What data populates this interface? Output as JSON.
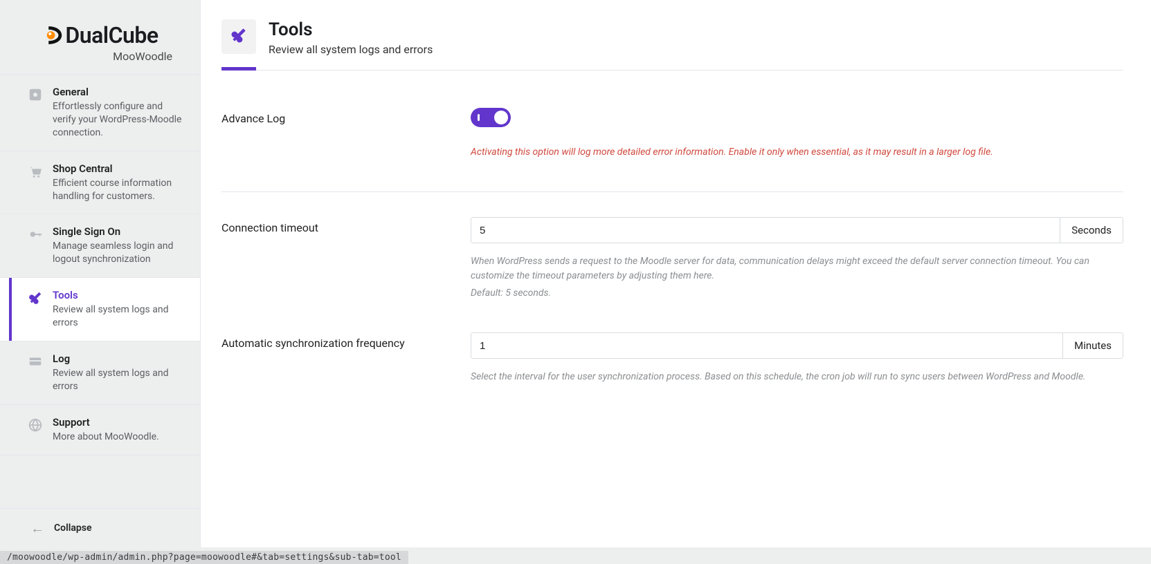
{
  "brand": {
    "name": "DualCube",
    "sub": "MooWoodle"
  },
  "sidebar": {
    "items": [
      {
        "title": "General",
        "desc": "Effortlessly configure and verify your WordPress-Moodle connection."
      },
      {
        "title": "Shop Central",
        "desc": "Efficient course information handling for customers."
      },
      {
        "title": "Single Sign On",
        "desc": "Manage seamless login and logout synchronization"
      },
      {
        "title": "Tools",
        "desc": "Review all system logs and errors"
      },
      {
        "title": "Log",
        "desc": "Review all system logs and errors"
      },
      {
        "title": "Support",
        "desc": "More about MooWoodle."
      }
    ],
    "collapse_label": "Collapse"
  },
  "header": {
    "title": "Tools",
    "subtitle": "Review all system logs and errors"
  },
  "settings": {
    "advance_log": {
      "label": "Advance Log",
      "help": "Activating this option will log more detailed error information. Enable it only when essential, as it may result in a larger log file."
    },
    "connection_timeout": {
      "label": "Connection timeout",
      "value": "5",
      "unit": "Seconds",
      "help_line1": "When WordPress sends a request to the Moodle server for data, communication delays might exceed the default server connection timeout. You can customize the timeout parameters by adjusting them here.",
      "help_line2": "Default: 5 seconds."
    },
    "sync_frequency": {
      "label": "Automatic synchronization frequency",
      "value": "1",
      "unit": "Minutes",
      "help": "Select the interval for the user synchronization process. Based on this schedule, the cron job will run to sync users between WordPress and Moodle."
    }
  },
  "status_url": "/moowoodle/wp-admin/admin.php?page=moowoodle#&tab=settings&sub-tab=tool"
}
